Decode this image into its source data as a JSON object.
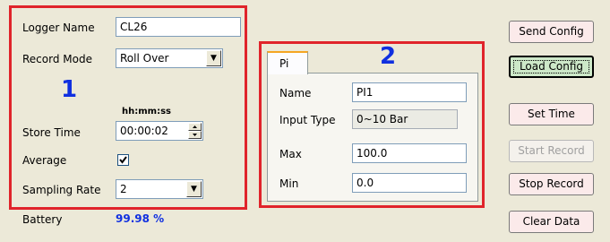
{
  "logger": {
    "name_label": "Logger Name",
    "name_value": "CL26",
    "record_mode_label": "Record Mode",
    "record_mode_value": "Roll Over",
    "section_number": "1",
    "time_format": "hh:mm:ss",
    "store_time_label": "Store Time",
    "store_time_value": "00:00:02",
    "average_label": "Average",
    "average_checked": true,
    "sampling_rate_label": "Sampling Rate",
    "sampling_rate_value": "2",
    "battery_label": "Battery",
    "battery_value": "99.98 %"
  },
  "channel": {
    "tab_label": "Pi",
    "section_number": "2",
    "name_label": "Name",
    "name_value": "PI1",
    "input_type_label": "Input Type",
    "input_type_value": "0~10 Bar",
    "max_label": "Max",
    "max_value": "100.0",
    "min_label": "Min",
    "min_value": "0.0"
  },
  "buttons": {
    "send_config": "Send Config",
    "load_config": "Load Config",
    "set_time": "Set Time",
    "start_record": "Start Record",
    "stop_record": "Stop Record",
    "clear_data": "Clear Data"
  },
  "colors": {
    "highlight_border": "#e0242b",
    "section_number": "#1030e0",
    "battery_value": "#1030e0",
    "button_face": "#fbeaea",
    "focused_button_face": "#cde8c8"
  }
}
